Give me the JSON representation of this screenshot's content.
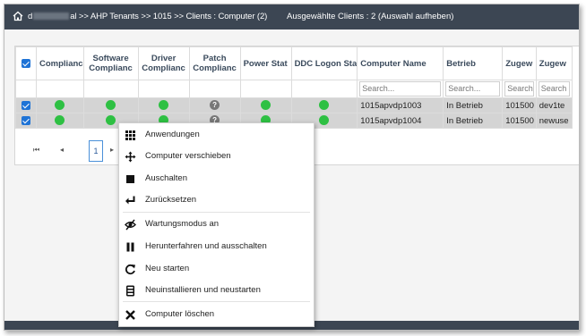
{
  "header": {
    "path_prefix": "d",
    "path_suffix": "al >> AHP Tenants >> 1015 >> Clients : Computer (2)",
    "selected_text": "Ausgewählte Clients : 2 (Auswahl aufheben)"
  },
  "columns": [
    "Complianc",
    "Software Complianc",
    "Driver Complianc",
    "Patch Complianc",
    "Power Stat",
    "DDC Logon Sta",
    "Computer Name",
    "Betrieb",
    "Zugew",
    "Zugew"
  ],
  "filters": [
    "Search...",
    "Search...",
    "Search",
    "Search"
  ],
  "rows": [
    {
      "compliance": "ok",
      "software": "ok",
      "driver": "ok",
      "patch": "unknown",
      "power": "ok",
      "ddc": "ok",
      "name": "1015apvdp1003",
      "betrieb": "In Betrieb",
      "zugew1": "101500",
      "zugew2": "dev1te"
    },
    {
      "compliance": "ok",
      "software": "ok",
      "driver": "ok",
      "patch": "unknown",
      "power": "ok",
      "ddc": "ok",
      "name": "1015apvdp1004",
      "betrieb": "In Betrieb",
      "zugew1": "101500",
      "zugew2": "newuse"
    }
  ],
  "pager": {
    "first": "⏮",
    "prev": "◂",
    "current": "1",
    "next": "▸"
  },
  "icons": {
    "ok_color": "#2ec043",
    "unknown": "?"
  },
  "context_menu": {
    "items": [
      {
        "label": "Anwendungen",
        "icon": "grid-icon"
      },
      {
        "label": "Computer verschieben",
        "icon": "move-icon"
      },
      {
        "label": "Auschalten",
        "icon": "stop-icon"
      },
      {
        "label": "Zurücksetzen",
        "icon": "return-icon"
      },
      {
        "label": "Wartungsmodus an",
        "icon": "eye-off-icon"
      },
      {
        "label": "Herunterfahren und ausschalten",
        "icon": "pause-icon"
      },
      {
        "label": "Neu starten",
        "icon": "restart-icon"
      },
      {
        "label": "Neuinstallieren und neustarten",
        "icon": "reinstall-icon"
      },
      {
        "label": "Computer löschen",
        "icon": "delete-icon"
      }
    ]
  }
}
